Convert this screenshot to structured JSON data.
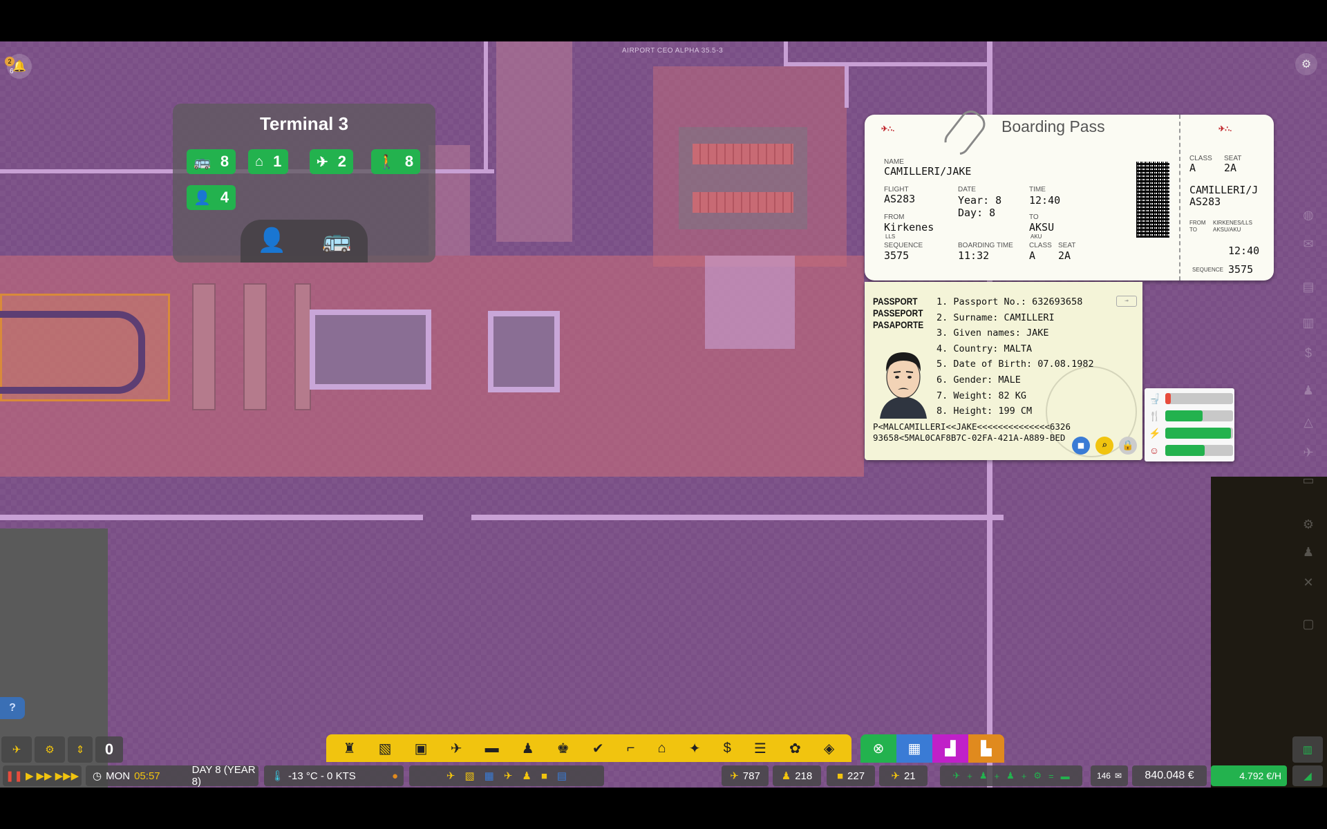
{
  "app": {
    "version": "AIRPORT CEO ALPHA 35.5-3"
  },
  "notifications": {
    "badge": "2",
    "count": "6"
  },
  "terminal": {
    "title": "Terminal 3",
    "stats": [
      {
        "icon": "bus-icon",
        "glyph": "🚌",
        "value": "8"
      },
      {
        "icon": "hangar-icon",
        "glyph": "⌂",
        "value": "1"
      },
      {
        "icon": "security-icon",
        "glyph": "✈",
        "value": "2"
      },
      {
        "icon": "departing-passenger-icon",
        "glyph": "🚶",
        "value": "8"
      },
      {
        "icon": "staff-icon",
        "glyph": "👤",
        "value": "4"
      }
    ],
    "modes": [
      {
        "icon": "passenger-icon",
        "glyph": "👤"
      },
      {
        "icon": "bus-plane-icon",
        "glyph": "🚌"
      }
    ]
  },
  "boarding_pass": {
    "title": "Boarding Pass",
    "logo": "✈∴.",
    "labels": {
      "name": "NAME",
      "flight": "FLIGHT",
      "date": "DATE",
      "time": "TIME",
      "from": "FROM",
      "to": "TO",
      "sequence": "SEQUENCE",
      "boarding_time": "BOARDING TIME",
      "class": "CLASS",
      "seat": "SEAT",
      "stub_from": "FROM",
      "stub_to": "TO",
      "stub_sequence": "SEQUENCE"
    },
    "name": "CAMILLERI/JAKE",
    "flight": "AS283",
    "date_year": "Year: 8",
    "date_day": "Day: 8",
    "time": "12:40",
    "from": "Kirkenes",
    "from_code": "LLS",
    "to": "AKSU",
    "to_code": "AKU",
    "sequence": "3575",
    "boarding_time": "11:32",
    "class": "A",
    "seat": "2A",
    "stub": {
      "class": "A",
      "seat": "2A",
      "name": "CAMILLERI/J",
      "flight": "AS283",
      "from": "KIRKENES/LLS",
      "to": "AKSU/AKU",
      "time": "12:40",
      "sequence": "3575"
    }
  },
  "passport": {
    "title_lines": [
      "PASSPORT",
      "PASSEPORT",
      "PASAPORTE"
    ],
    "fields": [
      "1. Passport No.: 632693658",
      "2. Surname: CAMILLERI",
      "3. Given names: JAKE",
      "4. Country: MALTA",
      "5. Date of Birth: 07.08.1982",
      "6. Gender: MALE",
      "7. Weight: 82 KG",
      "8. Height: 199 CM"
    ],
    "mrz_line1": "P<MALCAMILLERI<<JAKE<<<<<<<<<<<<<<6326",
    "mrz_line2": "93658<5MAL0CAF8B7C-02FA-421A-A889-BED"
  },
  "needs": [
    {
      "icon": "toilet-icon",
      "glyph": "🚽",
      "level": 0.08,
      "color": "#e74c3c"
    },
    {
      "icon": "food-icon",
      "glyph": "🍴",
      "level": 0.55,
      "color": "#23b24e"
    },
    {
      "icon": "energy-icon",
      "glyph": "⚡",
      "level": 0.97,
      "color": "#23b24e"
    },
    {
      "icon": "happiness-icon",
      "glyph": "☺",
      "level": 0.58,
      "color": "#23b24e"
    }
  ],
  "hud": {
    "day": "MON",
    "clock": "05:57",
    "date": "DAY 8 (YEAR 8)",
    "weather": "-13 °C - 0 KTS",
    "speed_counter": "0",
    "stats": {
      "passengers": "787",
      "staff": "218",
      "luggage": "227",
      "flights": "21"
    },
    "mail": "146",
    "money": "840.048 €",
    "income": "4.792 €/H",
    "help": "?"
  },
  "colors": {
    "map": "#7a4f86",
    "terminal_zone": "#b8707f",
    "green": "#23b24e",
    "yellow": "#f1c40f"
  }
}
